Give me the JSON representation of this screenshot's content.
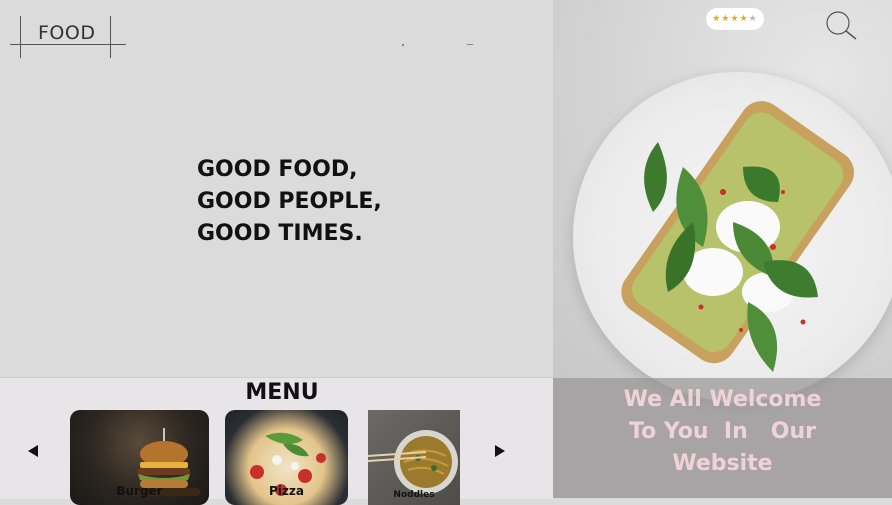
{
  "brand": {
    "logo": "FOOD"
  },
  "hero": {
    "lines": [
      "GOOD FOOD,",
      "GOOD PEOPLE,",
      "GOOD TIMES."
    ]
  },
  "rating": {
    "value": 4,
    "max": 5
  },
  "welcome": {
    "lines": [
      "We All Welcome",
      "To You  In   Our",
      "Website"
    ]
  },
  "menu": {
    "title": "MENU",
    "items": [
      {
        "label": "Burger"
      },
      {
        "label": "Pizza"
      },
      {
        "label": "Noddles"
      }
    ]
  },
  "colors": {
    "welcome_text": "#f0d3da",
    "rating_star": "#e0b100",
    "background": "#dcdbdc"
  },
  "icons": [
    "search-icon",
    "star-icon",
    "arrow-left-icon",
    "arrow-right-icon"
  ]
}
